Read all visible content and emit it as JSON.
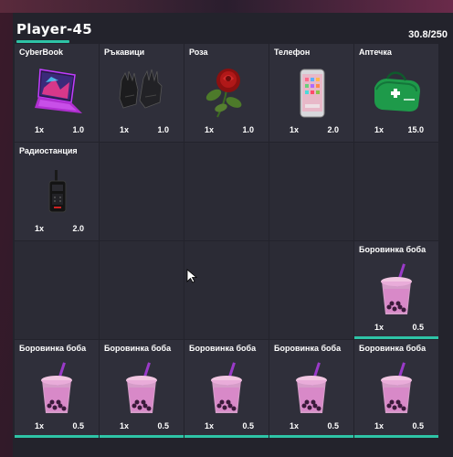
{
  "header": {
    "player_name": "Player-45",
    "weight": "30.8/250"
  },
  "colors": {
    "accent": "#2ec4a6",
    "panel": "#23232c",
    "slot": "#2b2b35"
  },
  "slots": [
    {
      "name": "CyberBook",
      "icon": "laptop-icon",
      "qty": "1x",
      "weight": "1.0"
    },
    {
      "name": "Ръкавици",
      "icon": "gloves-icon",
      "qty": "1x",
      "weight": "1.0"
    },
    {
      "name": "Роза",
      "icon": "rose-icon",
      "qty": "1x",
      "weight": "1.0"
    },
    {
      "name": "Телефон",
      "icon": "phone-icon",
      "qty": "1x",
      "weight": "2.0"
    },
    {
      "name": "Аптечка",
      "icon": "first-aid-kit-icon",
      "qty": "1x",
      "weight": "15.0"
    },
    {
      "name": "Радиостанция",
      "icon": "radio-icon",
      "qty": "1x",
      "weight": "2.0"
    },
    {
      "name": "Боровинка боба",
      "icon": "bubble-tea-icon",
      "qty": "1x",
      "weight": "0.5",
      "durability": 1.0
    },
    {
      "name": "Боровинка боба",
      "icon": "bubble-tea-icon",
      "qty": "1x",
      "weight": "0.5",
      "durability": 1.0
    },
    {
      "name": "Боровинка боба",
      "icon": "bubble-tea-icon",
      "qty": "1x",
      "weight": "0.5",
      "durability": 1.0
    },
    {
      "name": "Боровинка боба",
      "icon": "bubble-tea-icon",
      "qty": "1x",
      "weight": "0.5",
      "durability": 1.0
    },
    {
      "name": "Боровинка боба",
      "icon": "bubble-tea-icon",
      "qty": "1x",
      "weight": "0.5",
      "durability": 1.0
    },
    {
      "name": "Боровинка боба",
      "icon": "bubble-tea-icon",
      "qty": "1x",
      "weight": "0.5",
      "durability": 1.0
    }
  ]
}
